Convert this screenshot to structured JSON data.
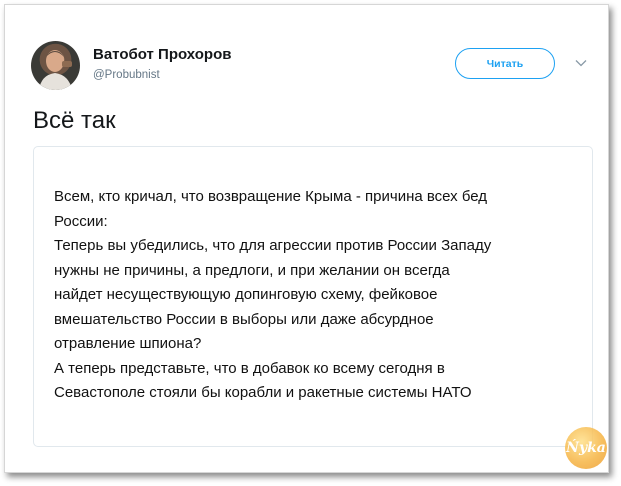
{
  "tweet": {
    "author_name": "Ватобот Прохоров",
    "author_handle": "@Probubnist",
    "follow_label": "Читать",
    "text": "Всё так"
  },
  "quoted_image": {
    "text": "Всем, кто кричал, что возвращение Крыма - причина всех бед\nРоссии:\nТеперь вы убедились, что для агрессии против России Западу\nнужны не причины, а предлоги, и при желании он всегда\nнайдет несуществующую допинговую схему, фейковое\nвмешательство России в выборы или даже абсурдное\nотравление шпиона?\nА теперь представьте, что в добавок ко всему сегодня в\nСевастополе стояли бы корабли и ракетные системы НАТО"
  },
  "watermark": {
    "text": "Ńyka"
  },
  "icons": {
    "avatar": "user-avatar",
    "menu": "chevron-down-icon"
  },
  "colors": {
    "accent": "#1da1f2",
    "name": "#14171a",
    "handle": "#657786",
    "border": "#e1e8ed"
  }
}
